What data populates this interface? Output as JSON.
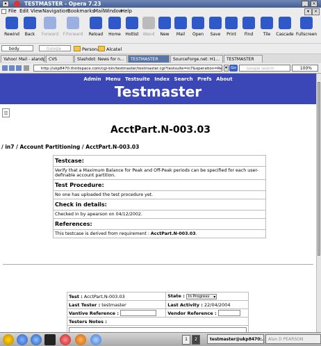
{
  "window": {
    "title": "TESTMASTER - Opera 7.23"
  },
  "menu": [
    "File",
    "Edit",
    "View",
    "Navigation",
    "Bookmarks",
    "Mail",
    "Window",
    "Help"
  ],
  "toolbar": {
    "buttons": [
      {
        "label": "Rewind",
        "color": "#2f58c8",
        "enabled": true
      },
      {
        "label": "Back",
        "color": "#2f58c8",
        "enabled": true
      },
      {
        "label": "Forward",
        "color": "#9bb0e0",
        "enabled": false
      },
      {
        "label": "F.Forward",
        "color": "#9bb0e0",
        "enabled": false
      },
      {
        "label": "Reload",
        "color": "#2f58c8",
        "enabled": true
      },
      {
        "label": "Home",
        "color": "#2f58c8",
        "enabled": true
      },
      {
        "label": "Hotlist",
        "color": "#2f58c8",
        "enabled": true
      },
      {
        "label": "Wand",
        "color": "#bbbbbb",
        "enabled": false
      },
      {
        "label": "New",
        "color": "#2f58c8",
        "enabled": true
      },
      {
        "label": "Mail",
        "color": "#2f58c8",
        "enabled": true
      },
      {
        "label": "Open",
        "color": "#2f58c8",
        "enabled": true
      },
      {
        "label": "Save",
        "color": "#2f58c8",
        "enabled": true
      },
      {
        "label": "Print",
        "color": "#2f58c8",
        "enabled": true
      },
      {
        "label": "Find",
        "color": "#2f58c8",
        "enabled": true
      },
      {
        "label": "Tile",
        "color": "#2f58c8",
        "enabled": true
      },
      {
        "label": "Cascade",
        "color": "#2f58c8",
        "enabled": true
      },
      {
        "label": "Fullscreen",
        "color": "#2f58c8",
        "enabled": true
      }
    ]
  },
  "personal_bar": {
    "search1": "body",
    "search2": "Google groups",
    "folders": [
      "Personal",
      "Alcatel"
    ]
  },
  "tabs": [
    {
      "label": "Yahoo! Mail - alandp...",
      "active": false
    },
    {
      "label": "CVS",
      "active": false
    },
    {
      "label": "Slashdot: News for n...",
      "active": false
    },
    {
      "label": "TESTMASTER",
      "active": true
    },
    {
      "label": "SourceForge.net: H1...",
      "active": false
    },
    {
      "label": "TESTMASTER",
      "active": false
    }
  ],
  "address": {
    "url": "http://ukp8470.thirdspace.com/cgi-bin/testmaster/testmaster.cgi?testsuite=in7&operation=Retrieve",
    "go": "Go",
    "search_placeholder": "Google search",
    "zoom": "100%"
  },
  "site": {
    "nav": [
      "Admin",
      "Menu",
      "Testsuite",
      "Index",
      "Search",
      "Prefs",
      "About"
    ],
    "brand": "Testmaster"
  },
  "testcase": {
    "heading": "AcctPart.N-003.03",
    "breadcrumb": "/ in7 / Account Partitioning / AcctPart.N-003.03",
    "sections": [
      {
        "title": "Testcase:",
        "body": "Verify that a Maximum Balance for Peak and Off-Peak periods can be specified for each user-definable account partition."
      },
      {
        "title": "Test Procedure:",
        "body": "No one has uploaded the test procedure yet."
      },
      {
        "title": "Check in details:",
        "body": "Checked in by apearson on 04/12/2002."
      },
      {
        "title": "References:",
        "body_prefix": "This testcase is derived from requirement : ",
        "body_bold": "AcctPart.N-003.03",
        "body_suffix": "."
      }
    ]
  },
  "info": {
    "test_label": "Test :",
    "test_value": "AcctPart.N-003.03",
    "state_label": "State :",
    "state_value": "In Progress",
    "tester_label": "Last Tester :",
    "tester_value": "testmaster",
    "activity_label": "Last Activity :",
    "activity_value": "22/04/2004",
    "vantive_label": "Vantive Reference :",
    "vendor_label": "Vendor Reference :",
    "notes_label": "Testers Notes :"
  },
  "taskbar": {
    "desktops": [
      "1",
      "2"
    ],
    "tasks": [
      "testmaster@ukp8470:...",
      "Alan D PEARSON"
    ]
  }
}
